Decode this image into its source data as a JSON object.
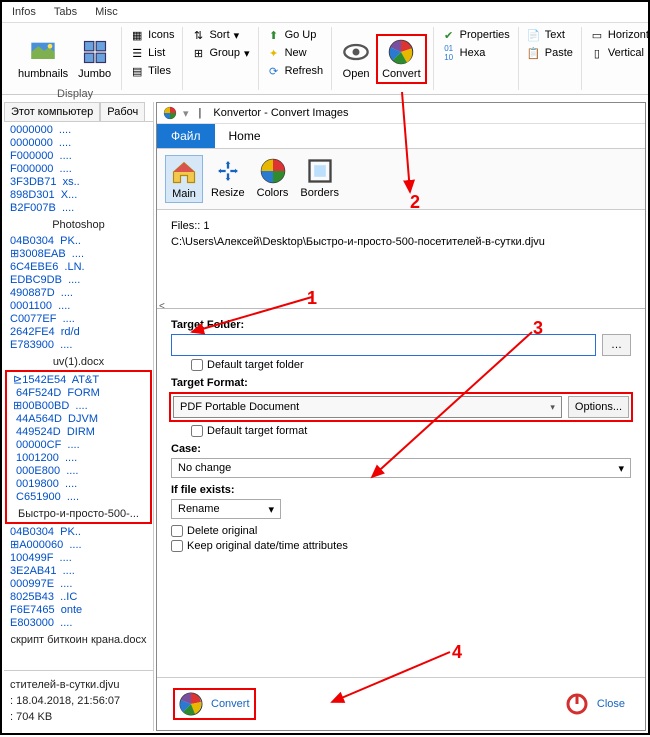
{
  "menu": {
    "infos": "Infos",
    "tabs": "Tabs",
    "misc": "Misc"
  },
  "ribbon": {
    "thumbnails": "humbnails",
    "jumbo": "Jumbo",
    "icons": "Icons",
    "list": "List",
    "tiles": "Tiles",
    "sort": "Sort",
    "group": "Group",
    "goup": "Go Up",
    "new": "New",
    "refresh": "Refresh",
    "open": "Open",
    "convert": "Convert",
    "properties": "Properties",
    "hexa": "Hexa",
    "text": "Text",
    "paste": "Paste",
    "horizontal": "Horizontal",
    "vertical": "Vertical",
    "display_label": "Display"
  },
  "leftpanel": {
    "tab1": "Этот компьютер",
    "tab2": "Рабоч",
    "block1": [
      "0000000  ....",
      "0000000  ....",
      "F000000  ....",
      "F000000  ....",
      "3F3DB71  xs..",
      "898D301  X...",
      "B2F007B  ...."
    ],
    "label1": "Photoshop",
    "block2": [
      "04B0304  PK..",
      "⊞3008EAB  ....",
      "6C4EBE6  .LN.",
      "EDBC9DB  ....",
      "490887D  ....",
      "0001100  ....",
      "C0077EF  ....",
      "2642FE4  rd/d",
      "E783900  ...."
    ],
    "label2": "uv(1).docx",
    "block3": [
      "⊵1542E54  AT&T",
      " 64F524D  FORM",
      "⊞00B00BD  ....",
      " 44A564D  DJVM",
      " 449524D  DIRM",
      " 00000CF  ....",
      " 1001200  ....",
      " 000E800  ....",
      " 0019800  ....",
      " C651900  ...."
    ],
    "label3": "Быстро-и-просто-500-...",
    "block4": [
      "04B0304  PK..",
      "⊞A000060  ....",
      "100499F  ....",
      "3E2AB41  ....",
      "000997E  ....",
      "8025B43  ..IC",
      "F6E7465  onte",
      "E803000  ...."
    ],
    "label4": "скрипт биткоин крана.docx",
    "status_file": "стителей-в-сутки.djvu",
    "status_date": ": 18.04.2018, 21:56:07",
    "status_size": ": 704 KB"
  },
  "dialog": {
    "title": "Konvertor - Convert Images",
    "tab_file": "Файл",
    "tab_home": "Home",
    "btn_main": "Main",
    "btn_resize": "Resize",
    "btn_colors": "Colors",
    "btn_borders": "Borders",
    "files_label": "Files:: 1",
    "path": "C:\\Users\\Алексей\\Desktop\\Быстро-и-просто-500-посетителей-в-сутки.djvu",
    "target_folder_label": "Target Folder:",
    "default_folder": "Default target folder",
    "target_format_label": "Target Format:",
    "format_value": "PDF    Portable Document",
    "options": "Options...",
    "default_format": "Default target format",
    "case_label": "Case:",
    "case_value": "No change",
    "ifexists_label": "If file exists:",
    "ifexists_value": "Rename",
    "delete_original": "Delete original",
    "keep_date": "Keep original date/time attributes",
    "convert": "Convert",
    "close": "Close"
  },
  "anno": {
    "n1": "1",
    "n2": "2",
    "n3": "3",
    "n4": "4"
  }
}
